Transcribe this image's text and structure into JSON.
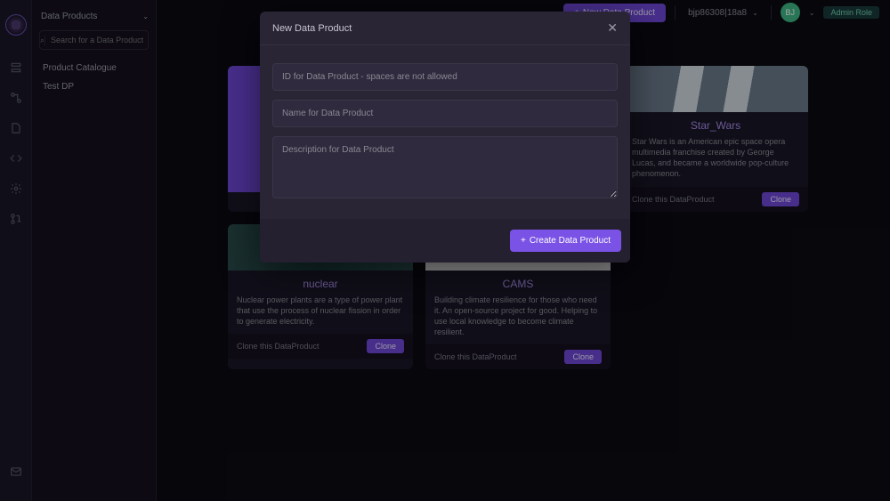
{
  "sidebar": {
    "title": "Data Products",
    "search_placeholder": "Search for a Data Product",
    "items": [
      {
        "label": "Product Catalogue"
      },
      {
        "label": "Test DP"
      }
    ]
  },
  "topbar": {
    "new_dp_label": "New Data Product",
    "tenant": "bjp86308|18a8",
    "avatar_initials": "BJ",
    "role_badge": "Admin Role"
  },
  "cards": [
    {
      "title": "Star_Wars",
      "desc": "Star Wars is an American epic space opera multimedia franchise created by George Lucas, and became a worldwide pop-culture phenomenon.",
      "footer_text": "Clone this DataProduct",
      "clone_label": "Clone"
    },
    {
      "title": "nuclear",
      "desc": "Nuclear power plants are a type of power plant that use the process of nuclear fission in order to generate electricity.",
      "footer_text": "Clone this DataProduct",
      "clone_label": "Clone"
    },
    {
      "title": "CAMS",
      "desc": "Building climate resilience for those who need it. An open-source project for good. Helping to use local knowledge to become climate resilient.",
      "footer_text": "Clone this DataProduct",
      "clone_label": "Clone"
    }
  ],
  "modal": {
    "title": "New Data Product",
    "id_placeholder": "ID for Data Product - spaces are not allowed",
    "name_placeholder": "Name for Data Product",
    "desc_placeholder": "Description for Data Product",
    "create_label": "Create Data Product"
  }
}
